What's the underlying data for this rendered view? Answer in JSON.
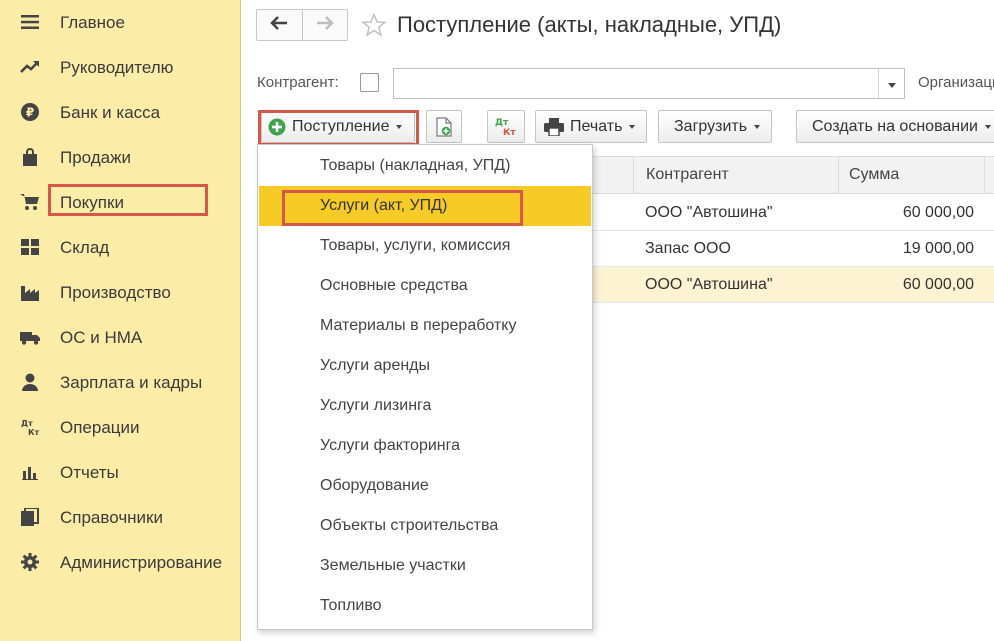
{
  "sidebar": {
    "items": [
      {
        "label": "Главное",
        "icon": "menu-icon"
      },
      {
        "label": "Руководителю",
        "icon": "trend-icon"
      },
      {
        "label": "Банк и касса",
        "icon": "ruble-icon"
      },
      {
        "label": "Продажи",
        "icon": "shopping-bag-icon"
      },
      {
        "label": "Покупки",
        "icon": "cart-icon"
      },
      {
        "label": "Склад",
        "icon": "warehouse-grid-icon"
      },
      {
        "label": "Производство",
        "icon": "factory-icon"
      },
      {
        "label": "ОС и НМА",
        "icon": "truck-icon"
      },
      {
        "label": "Зарплата и кадры",
        "icon": "person-icon"
      },
      {
        "label": "Операции",
        "icon": "dt-kt-icon"
      },
      {
        "label": "Отчеты",
        "icon": "bar-chart-icon"
      },
      {
        "label": "Справочники",
        "icon": "books-icon"
      },
      {
        "label": "Администрирование",
        "icon": "gear-icon"
      }
    ],
    "selected": "Покупки"
  },
  "header": {
    "title": "Поступление (акты, накладные, УПД)"
  },
  "filter": {
    "counterparty_label": "Контрагент:",
    "counterparty_value": "",
    "organization_label": "Организаци"
  },
  "toolbar": {
    "receipt_label": "Поступление",
    "dtkt_top": "Дт",
    "dtkt_bottom": "Кт",
    "print_label": "Печать",
    "load_label": "Загрузить",
    "create_based_label": "Создать на основании"
  },
  "table": {
    "columns": [
      "Контрагент",
      "Сумма"
    ],
    "rows": [
      {
        "counterparty": "ООО \"Автошина\"",
        "amount": "60 000,00"
      },
      {
        "counterparty": "Запас ООО",
        "amount": "19 000,00"
      },
      {
        "counterparty": "ООО \"Автошина\"",
        "amount": "60 000,00"
      }
    ]
  },
  "dropdown": {
    "items": [
      "Товары (накладная, УПД)",
      "Услуги (акт, УПД)",
      "Товары, услуги, комиссия",
      "Основные средства",
      "Материалы в переработку",
      "Услуги аренды",
      "Услуги лизинга",
      "Услуги факторинга",
      "Оборудование",
      "Объекты строительства",
      "Земельные участки",
      "Топливо"
    ],
    "active_item": "Услуги (акт, УПД)"
  },
  "colors": {
    "sidebar_bg": "#fbeca8",
    "highlight_border": "#d8574a",
    "active_item_bg": "#f7cb25",
    "selected_row_bg": "#fcf3d3",
    "accent_green": "#3fa34d"
  }
}
